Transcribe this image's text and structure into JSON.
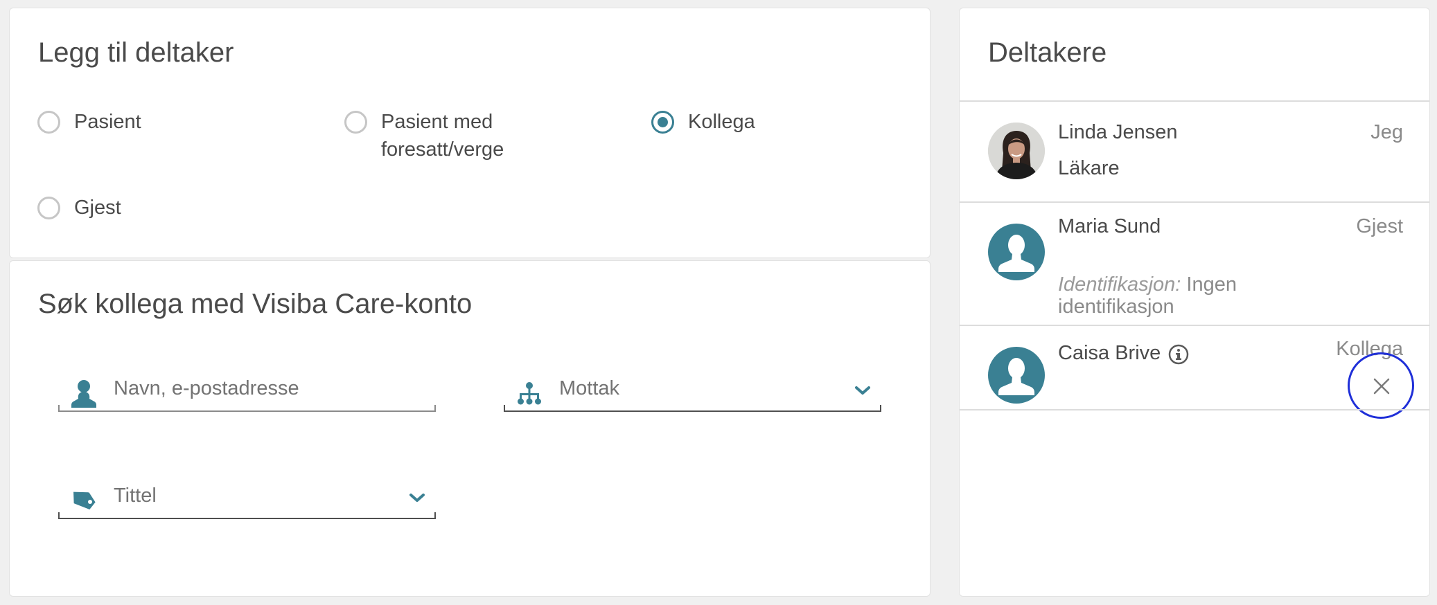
{
  "add_participant": {
    "title": "Legg til deltaker",
    "options": [
      {
        "label": "Pasient",
        "checked": false
      },
      {
        "label_line1": "Pasient med",
        "label_line2": "foresatt/verge",
        "checked": false
      },
      {
        "label": "Kollega",
        "checked": true
      },
      {
        "label": "Gjest",
        "checked": false
      }
    ]
  },
  "search": {
    "title": "Søk kollega med Visiba Care-konto",
    "name_field": {
      "placeholder": "Navn, e-postadresse",
      "icon": "person-icon"
    },
    "unit_select": {
      "value": "Mottak",
      "icon": "org-chart-icon"
    },
    "title_select": {
      "value": "Tittel",
      "icon": "tag-icon"
    }
  },
  "participants": {
    "title": "Deltakere",
    "items": [
      {
        "name": "Linda Jensen",
        "role": "Jeg",
        "subtitle": "Läkare",
        "avatar": "photo"
      },
      {
        "name": "Maria Sund",
        "role": "Gjest",
        "id_label": "Identifikasjon:",
        "id_value": "Ingen identifikasjon",
        "avatar": "placeholder"
      },
      {
        "name": "Caisa Brive",
        "role": "Kollega",
        "avatar": "placeholder",
        "info_icon": "info-icon",
        "remove_icon": "close-icon"
      }
    ]
  },
  "colors": {
    "accent": "#3a8093",
    "focus_ring": "#1f2fd8",
    "background": "#f0f0f0"
  }
}
